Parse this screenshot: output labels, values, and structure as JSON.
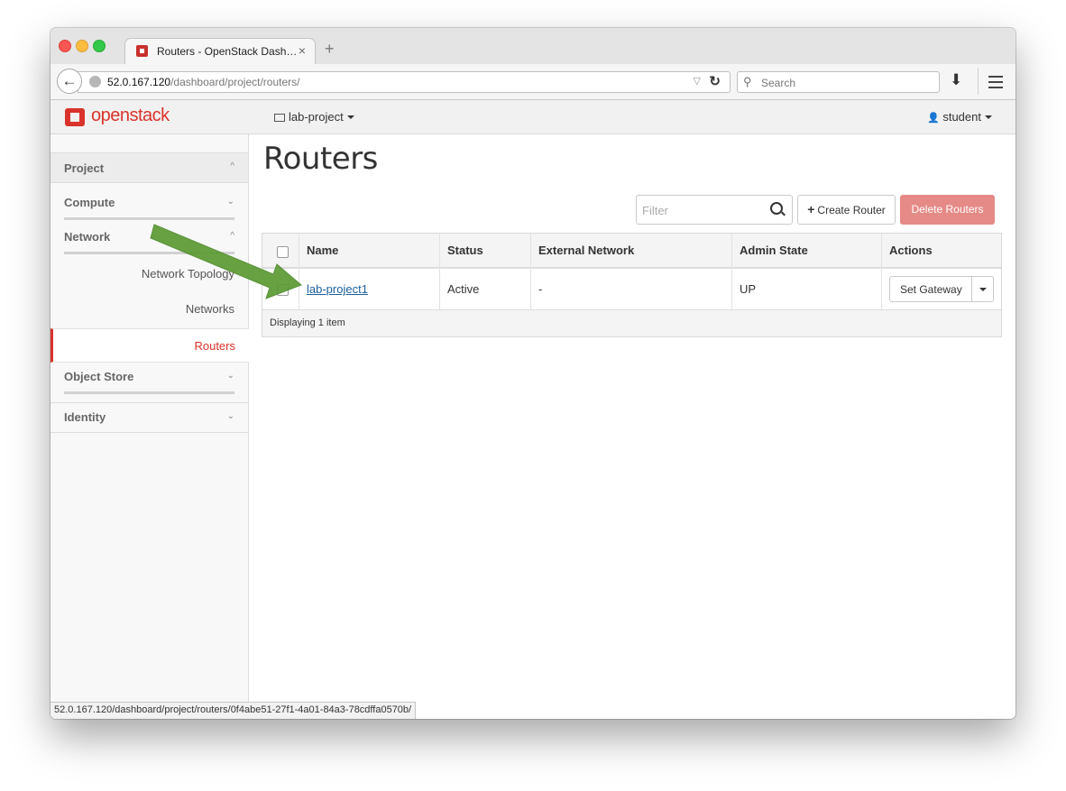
{
  "browser": {
    "tab_title": "Routers - OpenStack Dash…",
    "tab_close": "×",
    "new_tab": "+",
    "back": "←",
    "url_host": "52.0.167.120",
    "url_path": "/dashboard/project/routers/",
    "url_dropdown": "▽",
    "reload": "↻",
    "search_placeholder": "Search",
    "search_icon": "⚲",
    "download_icon": "⬇",
    "status_url": "52.0.167.120/dashboard/project/routers/0f4abe51-27f1-4a01-84a3-78cdffa0570b/"
  },
  "header": {
    "logo_text": "openstack",
    "project_label": "lab-project",
    "user_icon": "👤",
    "user_label": "student"
  },
  "sidebar": {
    "project": "Project",
    "compute": "Compute",
    "network": "Network",
    "items": [
      {
        "label": "Network Topology"
      },
      {
        "label": "Networks"
      },
      {
        "label": "Routers"
      }
    ],
    "object_store": "Object Store",
    "identity": "Identity",
    "chevron_up": "^",
    "chevron_down": "⌄"
  },
  "main": {
    "title": "Routers",
    "filter_placeholder": "Filter",
    "create_label": "Create Router",
    "create_plus": "+",
    "delete_label": "Delete Routers",
    "table": {
      "headers": [
        "Name",
        "Status",
        "External Network",
        "Admin State",
        "Actions"
      ],
      "rows": [
        {
          "name": "lab-project1",
          "status": "Active",
          "external_network": "-",
          "admin_state": "UP",
          "action": "Set Gateway"
        }
      ],
      "footer": "Displaying 1 item"
    }
  },
  "colors": {
    "brand_red": "#d9332b",
    "link_blue": "#1c5f9e",
    "delete_btn": "#e58a86",
    "annotation_arrow": "#5b9a32"
  }
}
